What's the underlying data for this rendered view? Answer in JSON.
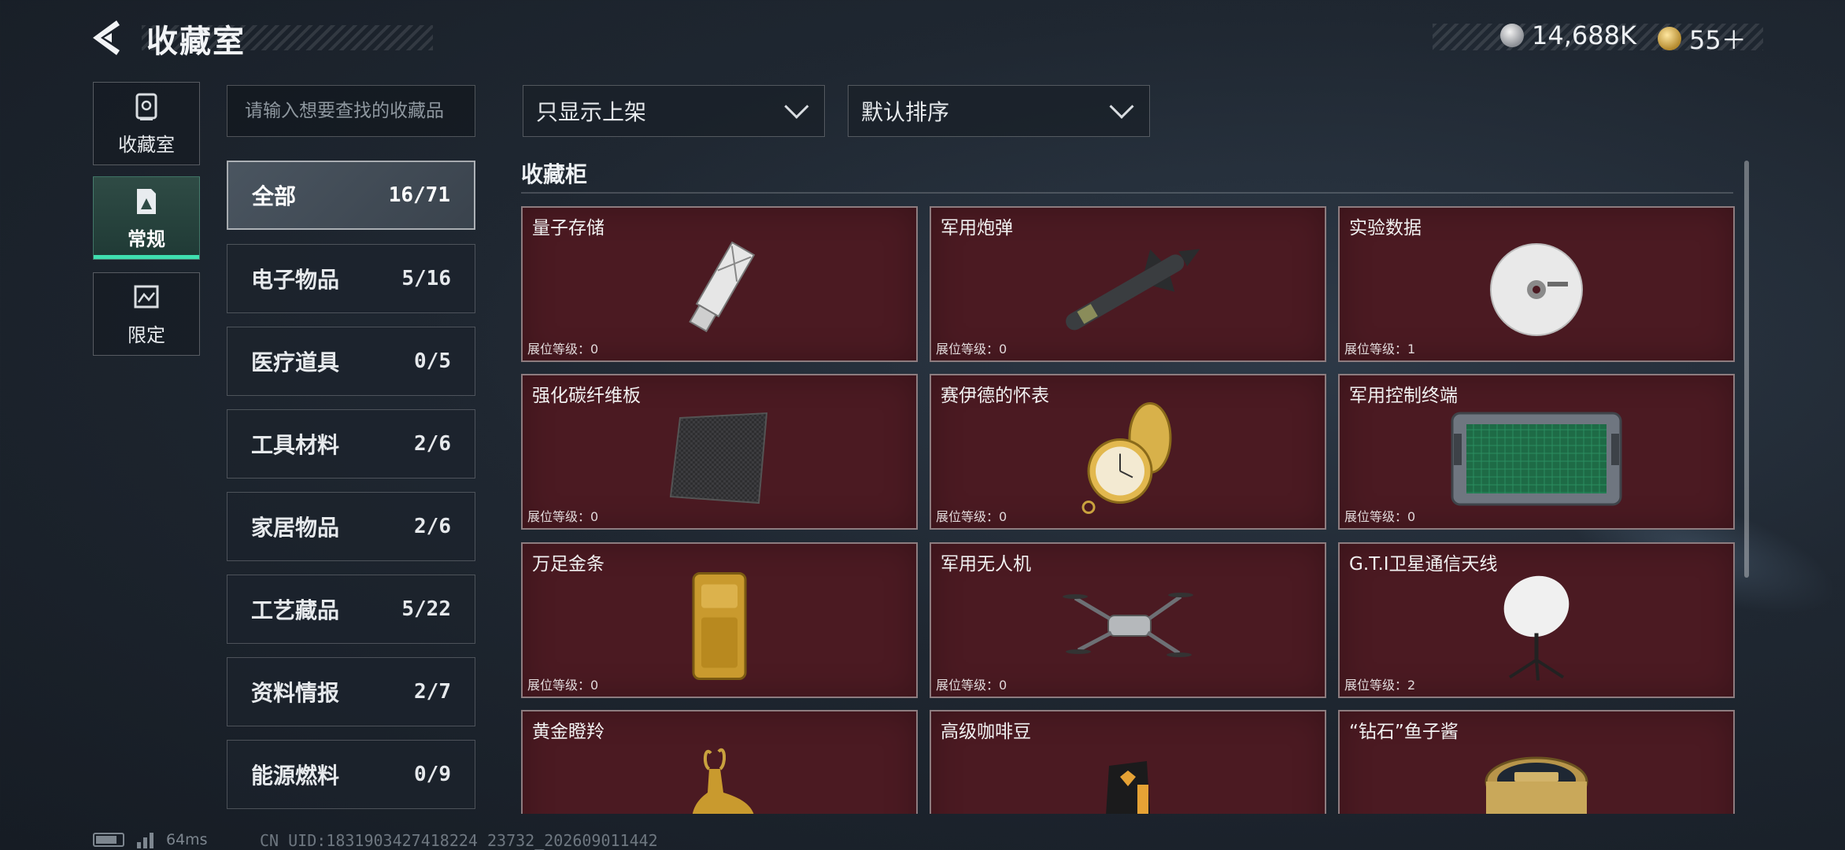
{
  "header": {
    "title": "收藏室",
    "currency": [
      {
        "icon": "silver-coin-icon",
        "value": "14,688K"
      },
      {
        "icon": "gold-coin-icon",
        "value": "55＋"
      }
    ]
  },
  "rail": [
    {
      "label": "收藏室",
      "icon": "vault-icon",
      "active": false
    },
    {
      "label": "常规",
      "icon": "regular-collection-icon",
      "active": true
    },
    {
      "label": "限定",
      "icon": "limited-collection-icon",
      "active": false
    }
  ],
  "search": {
    "placeholder": "请输入想要查找的收藏品",
    "value": ""
  },
  "subcategories": [
    {
      "label": "全部",
      "count": "16/71",
      "active": true
    },
    {
      "label": "电子物品",
      "count": "5/16"
    },
    {
      "label": "医疗道具",
      "count": "0/5"
    },
    {
      "label": "工具材料",
      "count": "2/6"
    },
    {
      "label": "家居物品",
      "count": "2/6"
    },
    {
      "label": "工艺藏品",
      "count": "5/22"
    },
    {
      "label": "资料情报",
      "count": "2/7"
    },
    {
      "label": "能源燃料",
      "count": "0/9"
    }
  ],
  "filters": {
    "shelf_filter": "只显示上架",
    "sort": "默认排序"
  },
  "section": {
    "title": "收藏柜"
  },
  "items": [
    {
      "name": "量子存储",
      "level": "展位等级：0",
      "icon": "usb-drive-icon"
    },
    {
      "name": "军用炮弹",
      "level": "展位等级：0",
      "icon": "missile-icon"
    },
    {
      "name": "实验数据",
      "level": "展位等级：1",
      "icon": "disc-icon"
    },
    {
      "name": "强化碳纤维板",
      "level": "展位等级：0",
      "icon": "carbon-plate-icon"
    },
    {
      "name": "赛伊德的怀表",
      "level": "展位等级：0",
      "icon": "pocket-watch-icon"
    },
    {
      "name": "军用控制终端",
      "level": "展位等级：0",
      "icon": "control-terminal-icon"
    },
    {
      "name": "万足金条",
      "level": "展位等级：0",
      "icon": "gold-bar-icon"
    },
    {
      "name": "军用无人机",
      "level": "展位等级：0",
      "icon": "drone-icon"
    },
    {
      "name": "G.T.I卫星通信天线",
      "level": "展位等级：2",
      "icon": "satellite-dish-icon"
    },
    {
      "name": "黄金瞪羚",
      "level": "",
      "icon": "golden-gazelle-icon"
    },
    {
      "name": "高级咖啡豆",
      "level": "",
      "icon": "coffee-bag-icon"
    },
    {
      "name": "“钻石”鱼子酱",
      "level": "",
      "icon": "caviar-tin-icon"
    }
  ],
  "status": {
    "ping": "64ms",
    "uid": "CN UID:1831903427418224 23732_202609011442"
  }
}
